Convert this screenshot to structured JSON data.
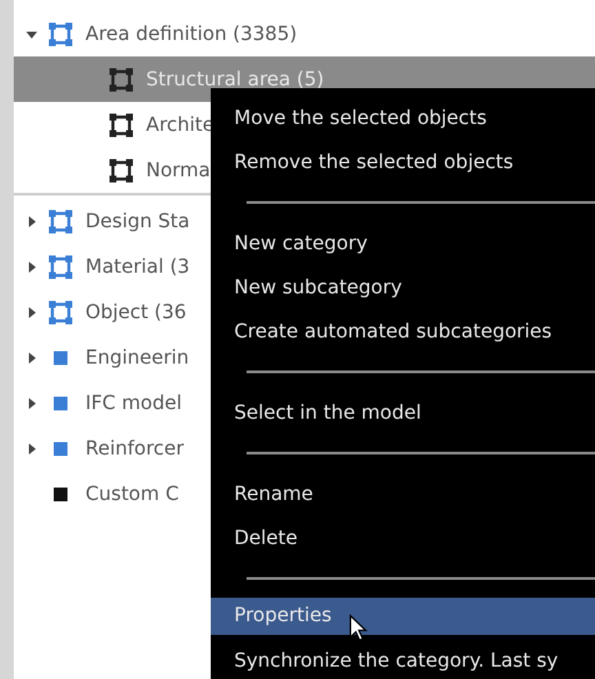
{
  "tree": [
    {
      "label": "Area definition (3385)",
      "kind": "frame",
      "color": "#3a7fd5",
      "expanded": true,
      "selected": false,
      "children": [
        {
          "label": "Structural area (5)",
          "kind": "frame",
          "color": "#222222",
          "selected": true
        },
        {
          "label": "Archite",
          "kind": "frame",
          "color": "#222222",
          "selected": false
        },
        {
          "label": "Norma",
          "kind": "frame",
          "color": "#222222",
          "selected": false
        }
      ]
    },
    {
      "label": "Design Sta",
      "kind": "frame",
      "color": "#3a7fd5",
      "expanded": false,
      "selected": false
    },
    {
      "label": "Material (3",
      "kind": "frame",
      "color": "#3a7fd5",
      "expanded": false,
      "selected": false
    },
    {
      "label": "Object (36",
      "kind": "frame",
      "color": "#3a7fd5",
      "expanded": false,
      "selected": false
    },
    {
      "label": "Engineerin",
      "kind": "square",
      "color": "#3a7fd5",
      "expanded": false,
      "selected": false
    },
    {
      "label": "IFC model",
      "kind": "square",
      "color": "#3a7fd5",
      "expanded": false,
      "selected": false
    },
    {
      "label": "Reinforcer",
      "kind": "square",
      "color": "#3a7fd5",
      "expanded": false,
      "selected": false
    },
    {
      "label": "Custom C",
      "kind": "square",
      "color": "#111111",
      "selected": false
    }
  ],
  "context_menu": {
    "items": [
      {
        "kind": "item",
        "label": "Move the selected objects",
        "selected": false
      },
      {
        "kind": "item",
        "label": "Remove the selected objects",
        "selected": false
      },
      {
        "kind": "separator"
      },
      {
        "kind": "item",
        "label": "New category",
        "selected": false
      },
      {
        "kind": "item",
        "label": "New subcategory",
        "selected": false
      },
      {
        "kind": "item",
        "label": "Create automated subcategories",
        "selected": false
      },
      {
        "kind": "separator"
      },
      {
        "kind": "item",
        "label": "Select in the model",
        "selected": false
      },
      {
        "kind": "separator"
      },
      {
        "kind": "item",
        "label": "Rename",
        "selected": false
      },
      {
        "kind": "item",
        "label": "Delete",
        "selected": false
      },
      {
        "kind": "separator"
      },
      {
        "kind": "item",
        "label": "Properties",
        "selected": true
      },
      {
        "kind": "item",
        "label": "Synchronize the category. Last sy",
        "selected": false
      }
    ]
  }
}
